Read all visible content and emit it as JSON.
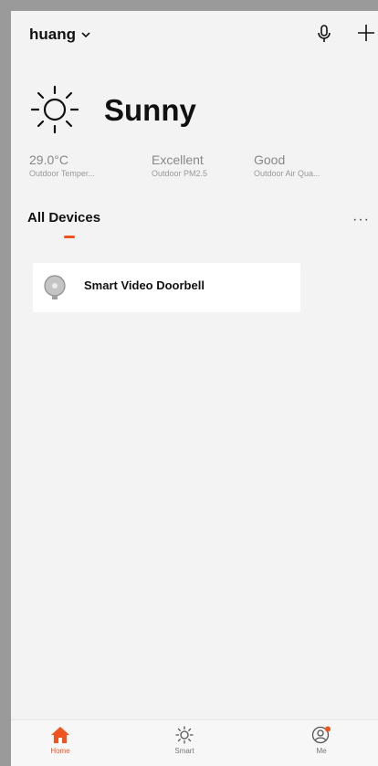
{
  "header": {
    "home_name": "huang"
  },
  "weather": {
    "condition": "Sunny",
    "stats": [
      {
        "value": "29.0°C",
        "label": "Outdoor Temper..."
      },
      {
        "value": "Excellent",
        "label": "Outdoor PM2.5"
      },
      {
        "value": "Good",
        "label": "Outdoor Air Qua..."
      }
    ]
  },
  "devices": {
    "title": "All Devices",
    "more": "···",
    "items": [
      {
        "name": "Smart Video Doorbell"
      }
    ]
  },
  "tabbar": {
    "tabs": [
      {
        "label": "Home",
        "active": true
      },
      {
        "label": "Smart",
        "active": false
      },
      {
        "label": "Me",
        "active": false
      }
    ]
  },
  "colors": {
    "accent": "#f0531f",
    "background": "#f3f3f3"
  }
}
